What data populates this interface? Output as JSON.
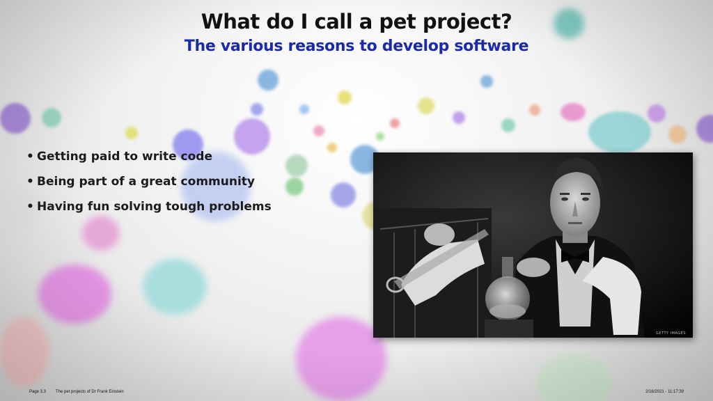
{
  "slide": {
    "title": "What do I call a pet project?",
    "subtitle": "The various reasons to develop software",
    "subtitle_color": "#1a2aa8"
  },
  "bullets": [
    "Getting paid to write code",
    "Being part of a great community",
    "Having fun solving tough problems"
  ],
  "image": {
    "description_icon": "scientist-photo",
    "watermark": "GETTY IMAGES"
  },
  "footer": {
    "page": "Page 3.3",
    "deck_name": "The pet projects of Dr Frank Einstein",
    "datetime": "2/16/2021 - 11:17:39"
  }
}
